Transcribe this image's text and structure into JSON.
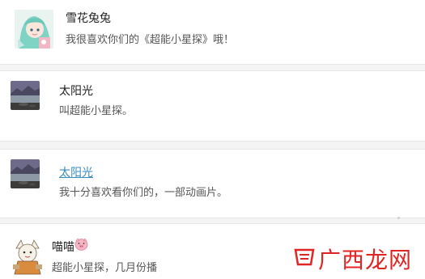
{
  "comments": [
    {
      "name": "雪花兔兔",
      "message": "我很喜欢你们的《超能小星探》哦！",
      "avatar": "anime-girl-avatar"
    },
    {
      "name": "太阳光",
      "message": "叫超能小星探。",
      "avatar": "landscape-avatar"
    },
    {
      "name": "太阳光",
      "message": "我十分喜欢看你们的，一部动画片。",
      "avatar": "landscape-avatar"
    },
    {
      "name": "喵喵",
      "message": "超能小星探，几月份播",
      "avatar": "cartoon-avatar",
      "name_emoji": "pig-face-emoji"
    }
  ],
  "watermark": {
    "text": "广西龙网",
    "logo": "watermark-logo-icon",
    "color": "#e02525"
  },
  "colors": {
    "link": "#3a8ec2",
    "name": "#222222",
    "message": "#555555",
    "background": "#f4f4f4"
  }
}
